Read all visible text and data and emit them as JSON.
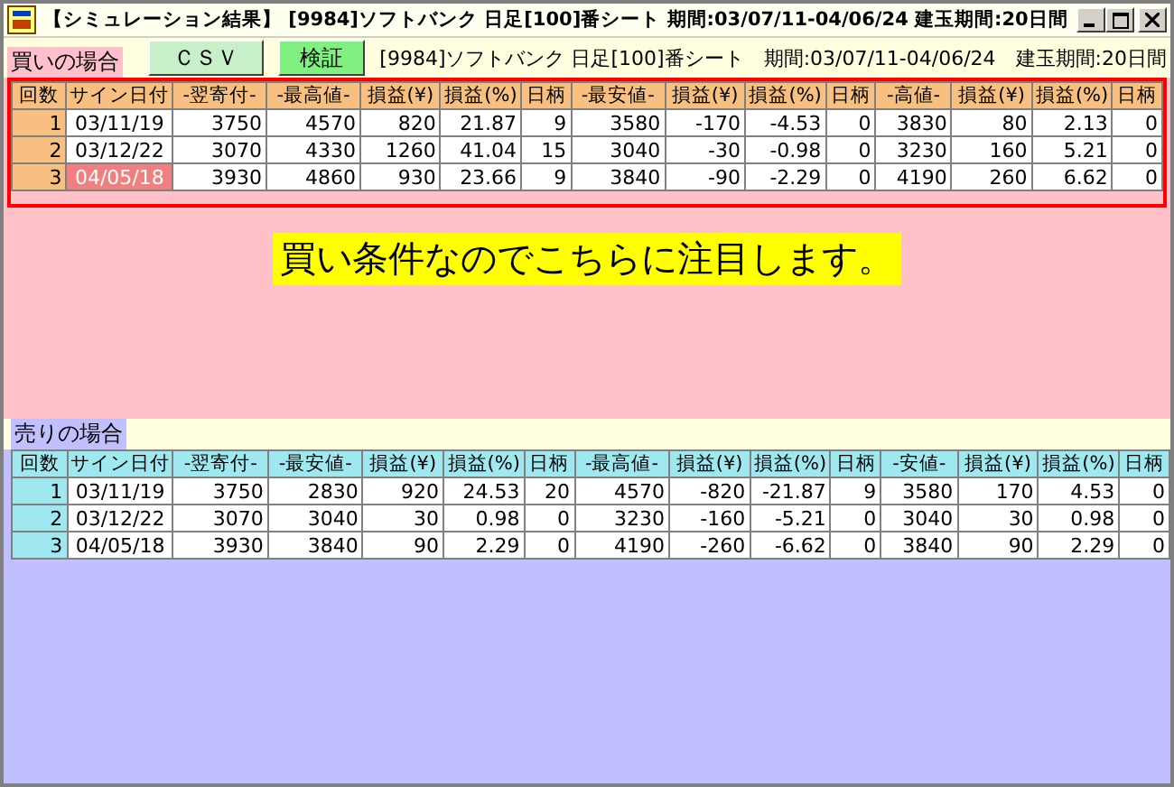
{
  "window": {
    "title": "【シミュレーション結果】 [9984]ソフトバンク 日足[100]番シート 期間:03/07/11-04/06/24 建玉期間:20日間"
  },
  "toolbar": {
    "buttons": [
      {
        "label": "ＣＳＶ",
        "kind": "csv"
      },
      {
        "label": "検証",
        "kind": "verify"
      }
    ],
    "info": "[9984]ソフトバンク 日足[100]番シート　期間:03/07/11-04/06/24　建玉期間:20日間"
  },
  "buy": {
    "label": "買いの場合",
    "columns": [
      "回数",
      "サイン日付",
      "-翌寄付-",
      "-最高値-",
      "損益(¥)",
      "損益(%)",
      "日柄",
      "-最安値-",
      "損益(¥)",
      "損益(%)",
      "日柄",
      "-高値-",
      "損益(¥)",
      "損益(%)",
      "日柄"
    ],
    "rows": [
      {
        "highlighted": false,
        "cells": [
          "1",
          "03/11/19",
          "3750",
          "4570",
          "820",
          "21.87",
          "9",
          "3580",
          "-170",
          "-4.53",
          "0",
          "3830",
          "80",
          "2.13",
          "0"
        ]
      },
      {
        "highlighted": false,
        "cells": [
          "2",
          "03/12/22",
          "3070",
          "4330",
          "1260",
          "41.04",
          "15",
          "3040",
          "-30",
          "-0.98",
          "0",
          "3230",
          "160",
          "5.21",
          "0"
        ]
      },
      {
        "highlighted": true,
        "cells": [
          "3",
          "04/05/18",
          "3930",
          "4860",
          "930",
          "23.66",
          "9",
          "3840",
          "-90",
          "-2.29",
          "0",
          "4190",
          "260",
          "6.62",
          "0"
        ]
      }
    ]
  },
  "annotation": "買い条件なのでこちらに注目します。",
  "sell": {
    "label": "売りの場合",
    "columns": [
      "回数",
      "サイン日付",
      "-翌寄付-",
      "-最安値-",
      "損益(¥)",
      "損益(%)",
      "日柄",
      "-最高値-",
      "損益(¥)",
      "損益(%)",
      "日柄",
      "-安値-",
      "損益(¥)",
      "損益(%)",
      "日柄"
    ],
    "rows": [
      {
        "highlighted": false,
        "cells": [
          "1",
          "03/11/19",
          "3750",
          "2830",
          "920",
          "24.53",
          "20",
          "4570",
          "-820",
          "-21.87",
          "9",
          "3580",
          "170",
          "4.53",
          "0"
        ]
      },
      {
        "highlighted": false,
        "cells": [
          "2",
          "03/12/22",
          "3070",
          "3040",
          "30",
          "0.98",
          "0",
          "3230",
          "-160",
          "-5.21",
          "0",
          "3040",
          "30",
          "0.98",
          "0"
        ]
      },
      {
        "highlighted": false,
        "cells": [
          "3",
          "04/05/18",
          "3930",
          "3840",
          "90",
          "2.29",
          "0",
          "4190",
          "-260",
          "-6.62",
          "0",
          "3840",
          "90",
          "2.29",
          "0"
        ]
      }
    ]
  }
}
